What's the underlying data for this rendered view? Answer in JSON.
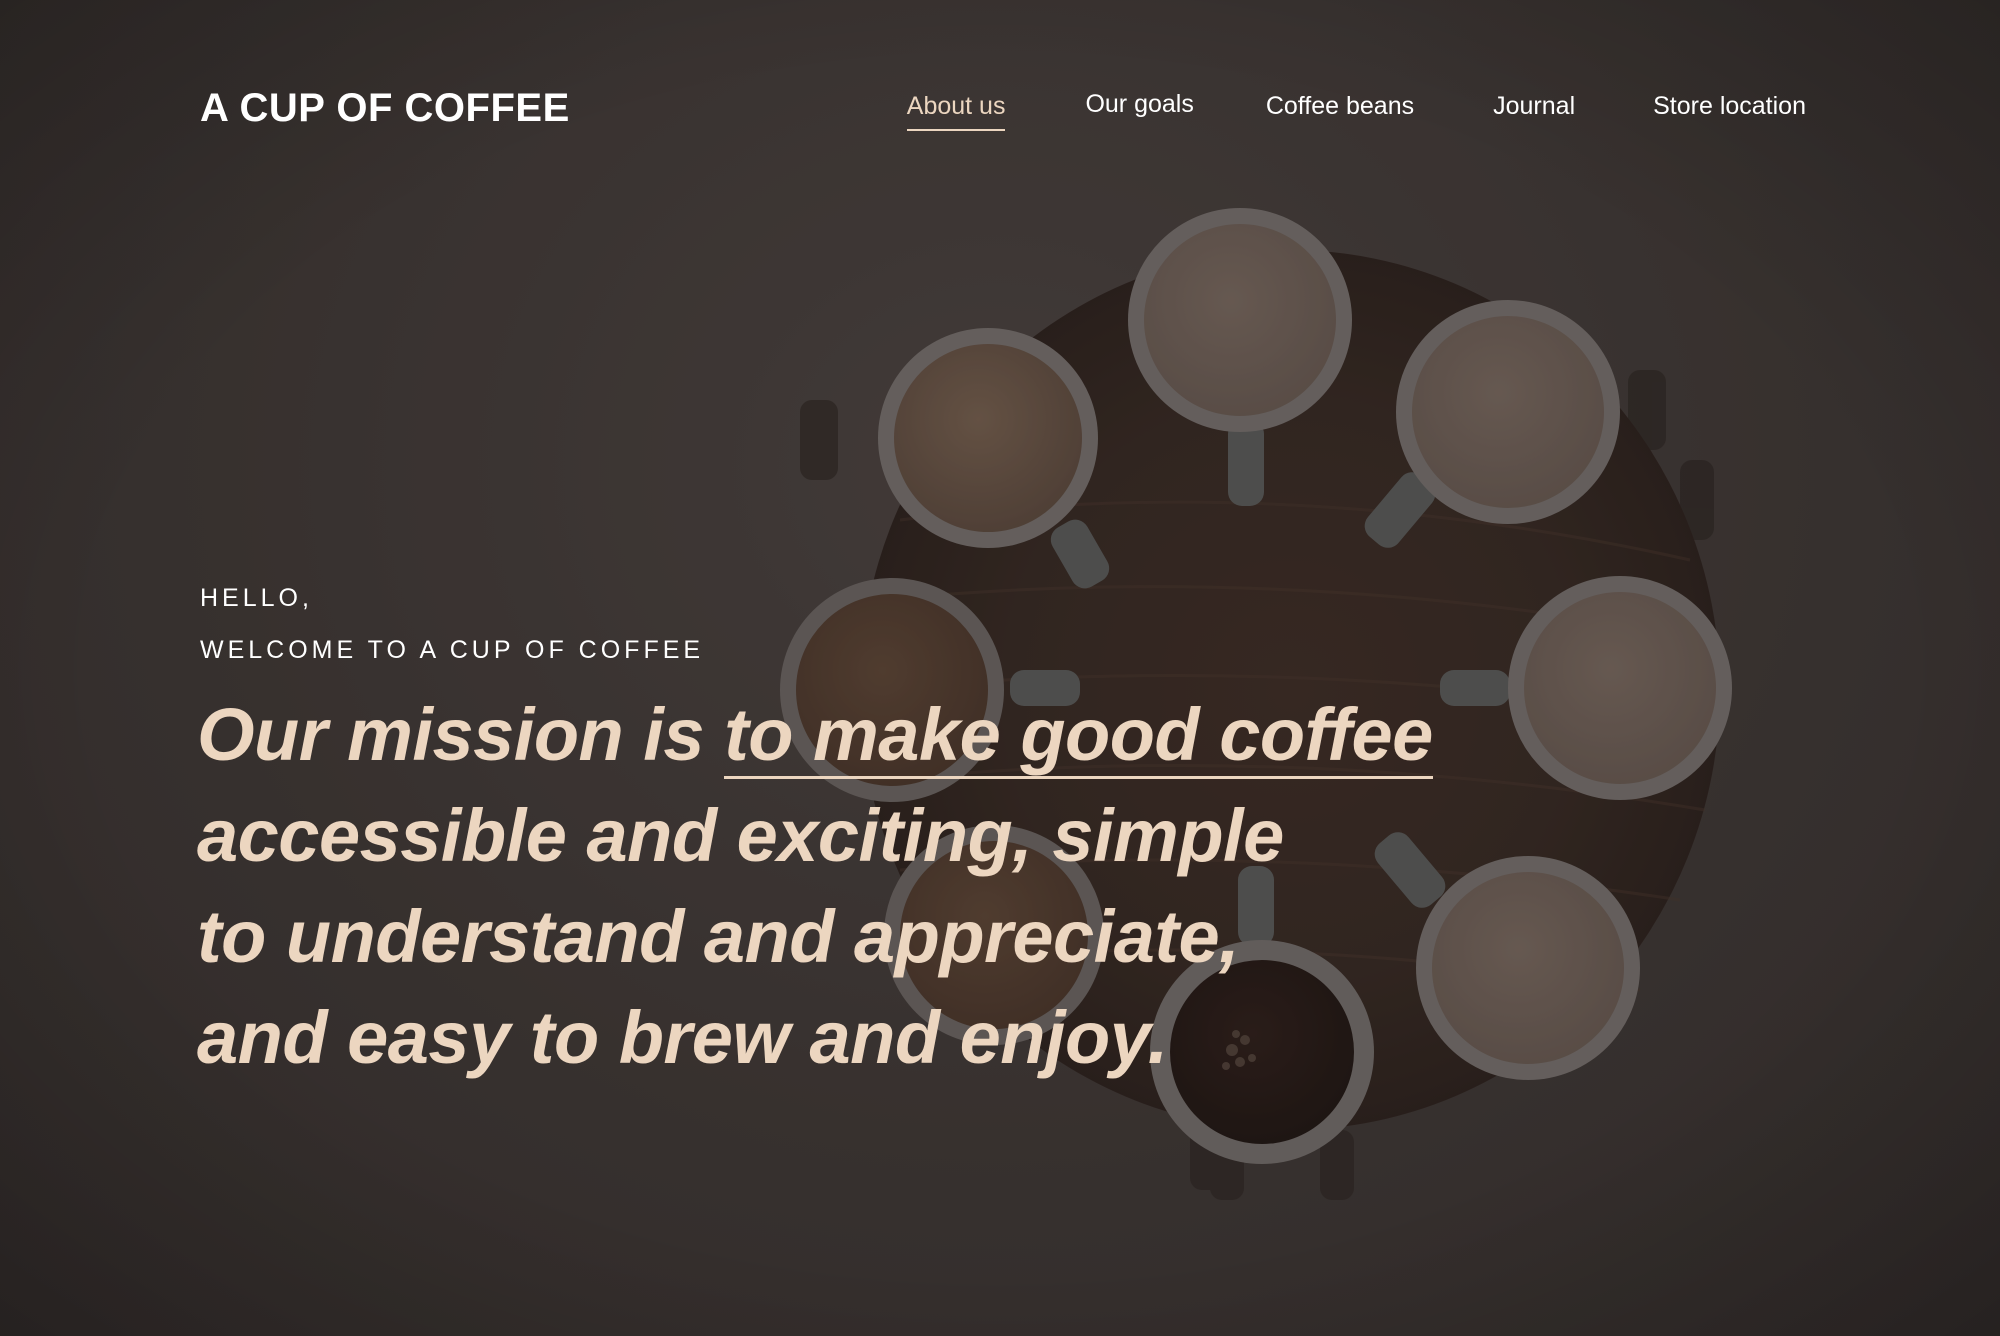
{
  "header": {
    "logo": "A CUP OF COFFEE",
    "nav": [
      {
        "label": "About us",
        "active": true
      },
      {
        "label": "Our goals",
        "active": false
      },
      {
        "label": "Coffee beans",
        "active": false
      },
      {
        "label": "Journal",
        "active": false
      },
      {
        "label": "Store location",
        "active": false
      }
    ]
  },
  "hero": {
    "greeting_line1": "HELLO,",
    "greeting_line2": "WELCOME TO A CUP OF COFFEE",
    "mission": {
      "line1_lead": "Our mission is ",
      "line1_highlight": "to make good coffee",
      "line2": "accessible and exciting, simple",
      "line3": "to understand and appreciate,",
      "line4": "and easy to brew and enjoy."
    }
  },
  "colors": {
    "background": "#3d3734",
    "accent": "#ecd6c0",
    "text": "#ffffff",
    "table": "#3a2a22"
  },
  "image": {
    "subject": "coffee-cups-on-round-wooden-table"
  }
}
